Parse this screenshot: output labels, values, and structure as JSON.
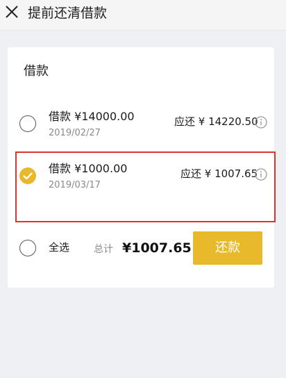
{
  "header": {
    "title": "提前还清借款",
    "close_icon": "close-icon"
  },
  "card": {
    "title": "借款",
    "loans": [
      {
        "name": "借款 ¥14000.00",
        "date": "2019/02/27",
        "due": "应还 ¥ 14220.50",
        "selected": false
      },
      {
        "name": "借款 ¥1000.00",
        "date": "2019/03/17",
        "due": "应还 ¥ 1007.65",
        "selected": true
      }
    ],
    "footer": {
      "select_all": "全选",
      "total_label": "总计",
      "total_amount": "¥1007.65",
      "repay_button": "还款"
    }
  },
  "colors": {
    "accent": "#e8b92a",
    "highlight_border": "#d9342b",
    "muted_text": "#8a8a8a"
  }
}
